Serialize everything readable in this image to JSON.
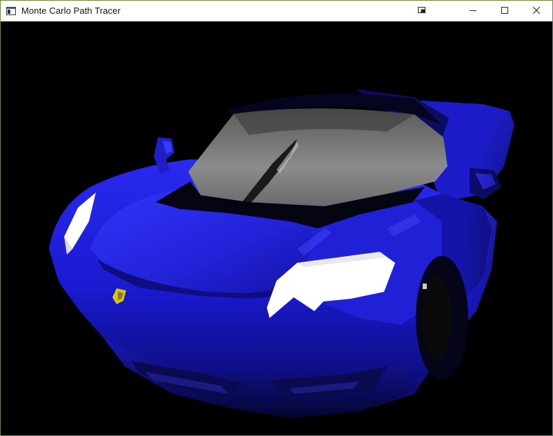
{
  "window": {
    "title": "Monte Carlo Path Tracer",
    "controls": {
      "extra": "window-layout-icon",
      "minimize": "minimize-icon",
      "maximize": "maximize-icon",
      "close": "close-icon"
    }
  },
  "render": {
    "subject": "blue sports car",
    "colors": {
      "background": "#000000",
      "body": "#1a1ad6",
      "body_dark": "#0a0a6e",
      "glass": "#8a8a8a",
      "headlight": "#ffffff",
      "badge": "#d4c21a"
    }
  }
}
